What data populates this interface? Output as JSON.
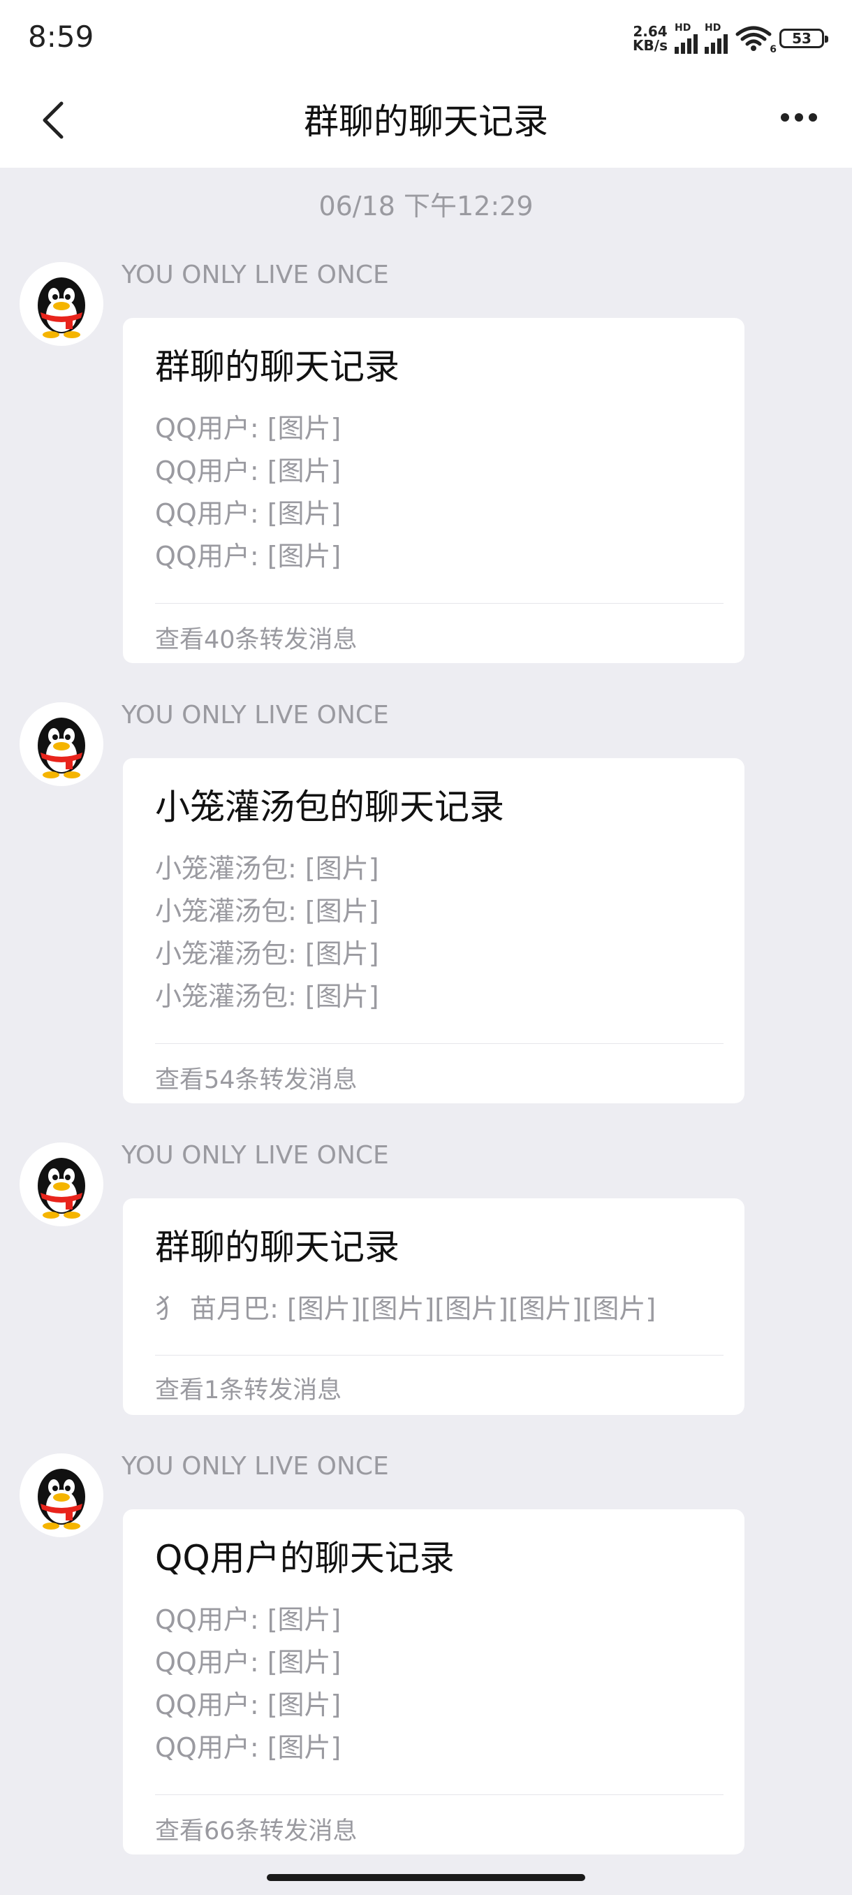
{
  "status": {
    "time": "8:59",
    "net_speed_value": "2.64",
    "net_speed_unit": "KB/s",
    "hd1": "HD",
    "hd2": "HD",
    "wifi_label": "6",
    "battery": "53"
  },
  "nav": {
    "title": "群聊的聊天记录",
    "back_icon": "chevron-left-icon",
    "more_icon": "more-dots-icon"
  },
  "timestamp": "06/18 下午12:29",
  "messages": [
    {
      "sender": "YOU ONLY LIVE ONCE",
      "title": "群聊的聊天记录",
      "preview": [
        "QQ用户: [图片]",
        "QQ用户: [图片]",
        "QQ用户: [图片]",
        "QQ用户: [图片]"
      ],
      "footer": "查看40条转发消息"
    },
    {
      "sender": "YOU ONLY LIVE ONCE",
      "title": "小笼灌汤包的聊天记录",
      "preview": [
        "小笼灌汤包: [图片]",
        "小笼灌汤包: [图片]",
        "小笼灌汤包: [图片]",
        "小笼灌汤包: [图片]"
      ],
      "footer": "查看54条转发消息"
    },
    {
      "sender": "YOU ONLY LIVE ONCE",
      "title": "群聊的聊天记录",
      "preview": [
        "犭 苗月巴: [图片][图片][图片][图片][图片]"
      ],
      "footer": "查看1条转发消息"
    },
    {
      "sender": "YOU ONLY LIVE ONCE",
      "title": "QQ用户的聊天记录",
      "preview": [
        "QQ用户: [图片]",
        "QQ用户: [图片]",
        "QQ用户: [图片]",
        "QQ用户: [图片]"
      ],
      "footer": "查看66条转发消息"
    }
  ]
}
